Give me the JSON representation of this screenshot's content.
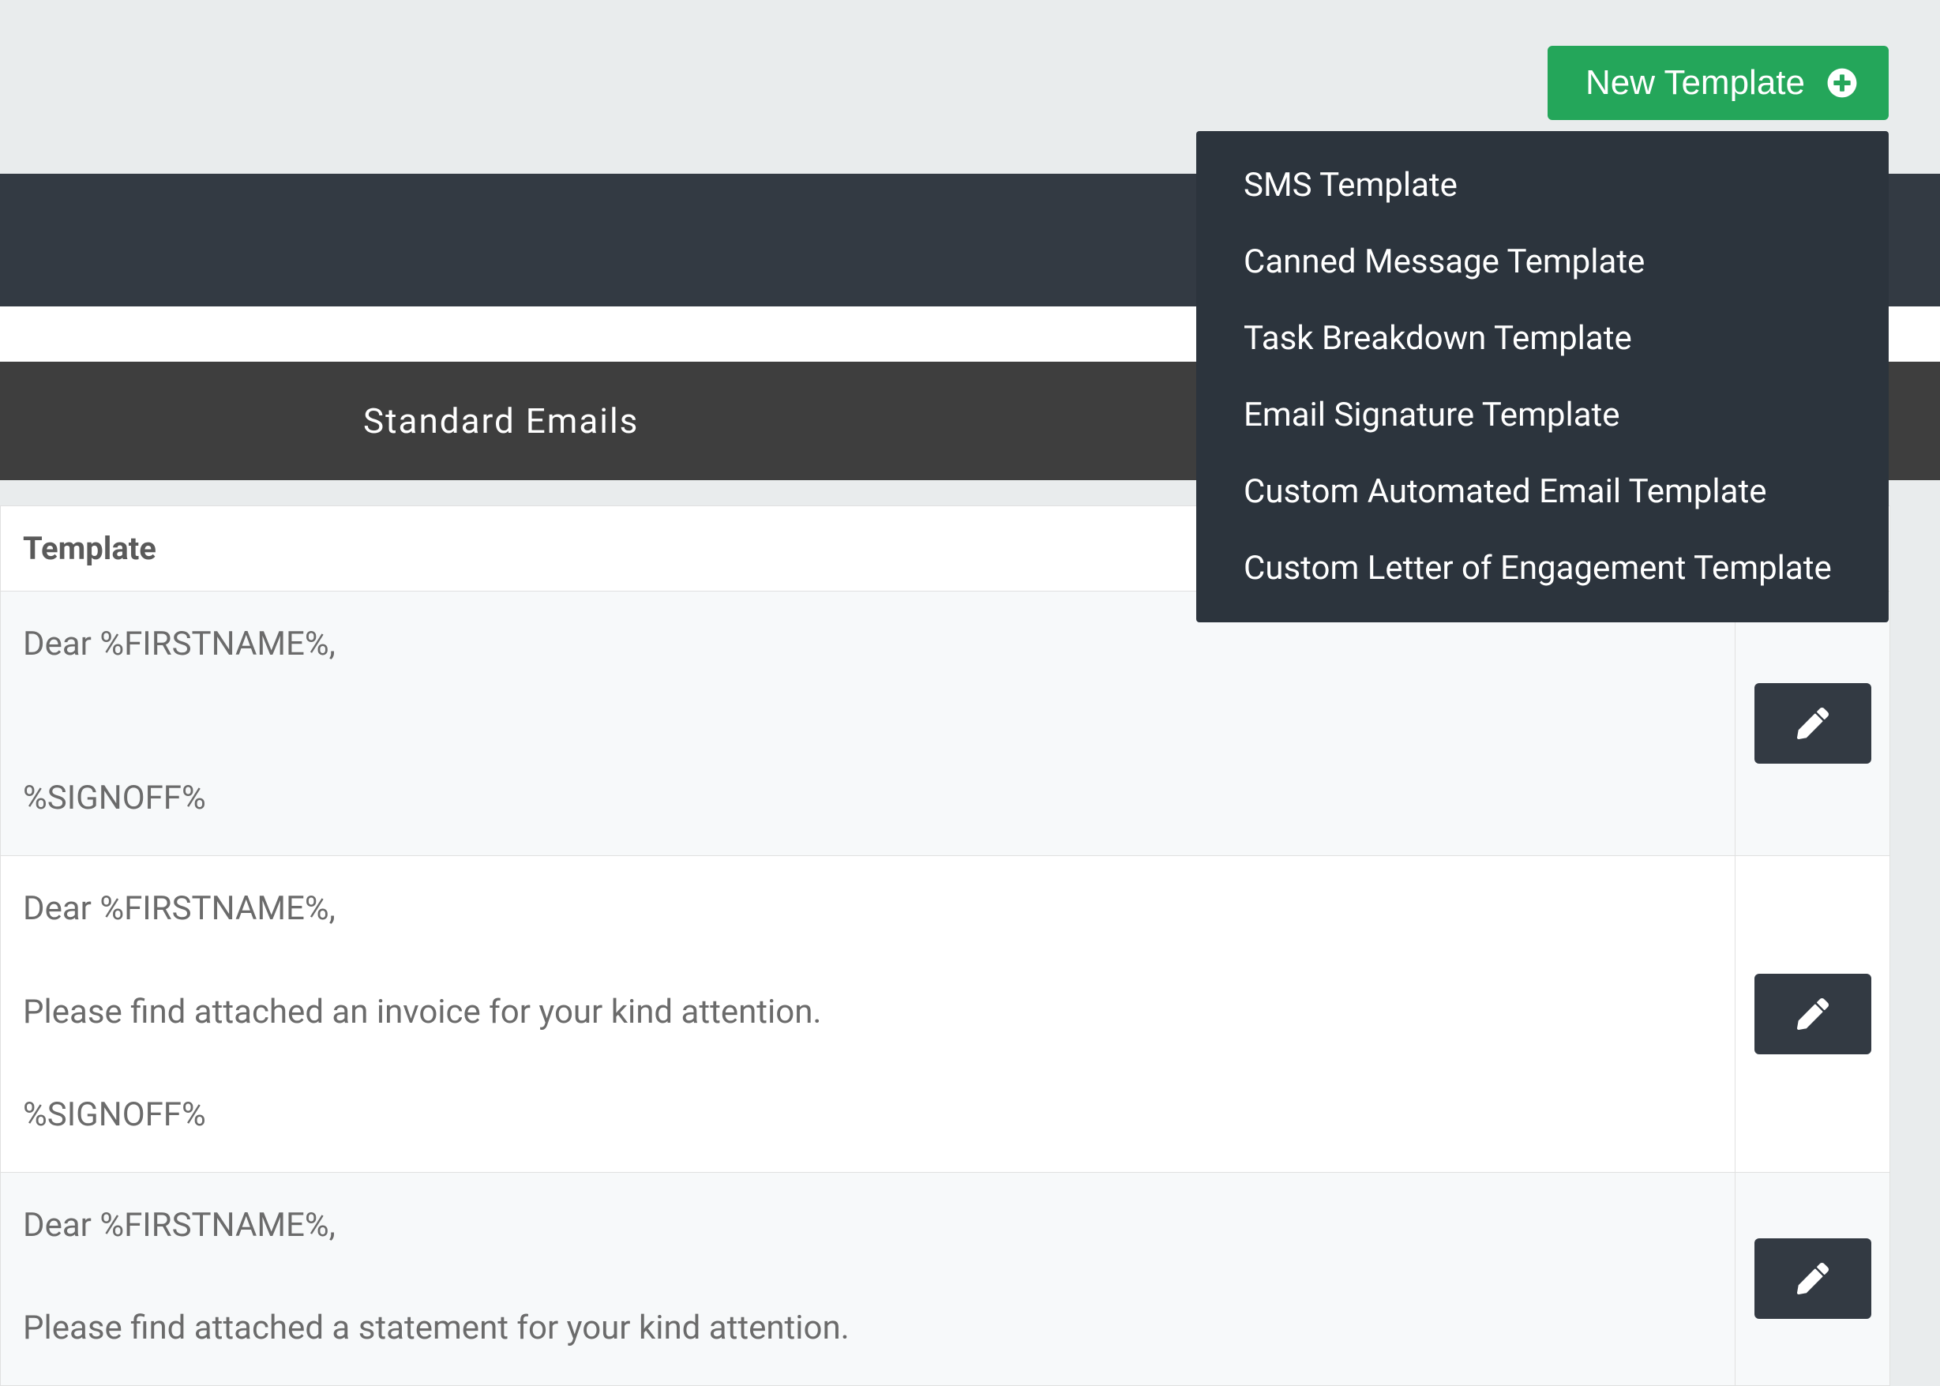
{
  "newTemplateButton": {
    "label": "New Template"
  },
  "dropdown": {
    "items": [
      "SMS Template",
      "Canned Message Template",
      "Task Breakdown Template",
      "Email Signature Template",
      "Custom Automated Email Template",
      "Custom Letter of Engagement Template"
    ]
  },
  "tab": {
    "title": "Standard Emails"
  },
  "table": {
    "columnHeader": "Template",
    "rows": [
      {
        "body": "Dear %FIRSTNAME%,\n\n\n%SIGNOFF%"
      },
      {
        "body": "Dear %FIRSTNAME%,\n\nPlease find attached an invoice for your kind attention.\n\n%SIGNOFF%"
      },
      {
        "body": "Dear %FIRSTNAME%,\n\nPlease find attached a statement for your kind attention.\n"
      }
    ]
  }
}
